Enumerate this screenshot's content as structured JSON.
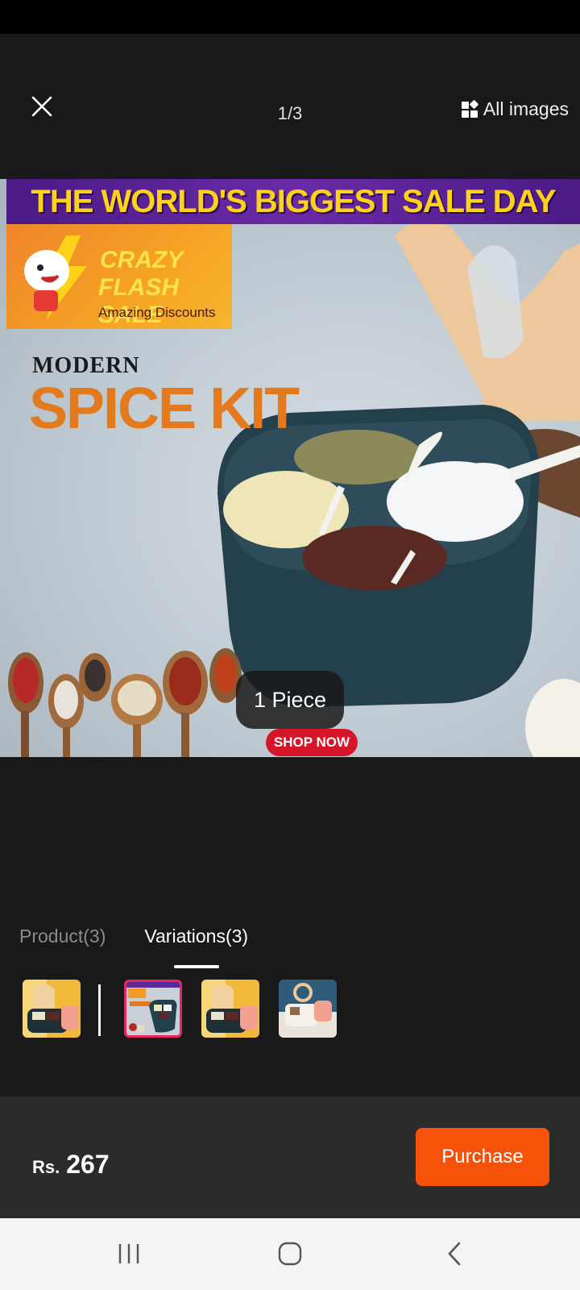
{
  "viewer": {
    "counter": "1/3",
    "all_images_label": "All images"
  },
  "product_image": {
    "banner_text": "THE WORLD'S BIGGEST SALE DAY",
    "flash_line1": "CRAZY",
    "flash_line2": "FLASH SALE",
    "flash_line3": "Amazing Discounts",
    "headline_small": "MODERN",
    "headline_large": "SPICE KIT",
    "shop_now": "SHOP NOW",
    "variant_label": "1 Piece"
  },
  "tabs": [
    {
      "label": "Product(3)",
      "active": false
    },
    {
      "label": "Variations(3)",
      "active": true
    }
  ],
  "thumbnails": [
    {
      "name": "product-thumb-1",
      "selected": false
    },
    {
      "name": "variation-thumb-1",
      "selected": true
    },
    {
      "name": "variation-thumb-2",
      "selected": false
    },
    {
      "name": "variation-thumb-3",
      "selected": false
    }
  ],
  "purchase_bar": {
    "currency": "Rs.",
    "price": "267",
    "button_label": "Purchase"
  },
  "colors": {
    "accent": "#f6520a",
    "selected_border": "#e8265c",
    "background": "#191919"
  }
}
